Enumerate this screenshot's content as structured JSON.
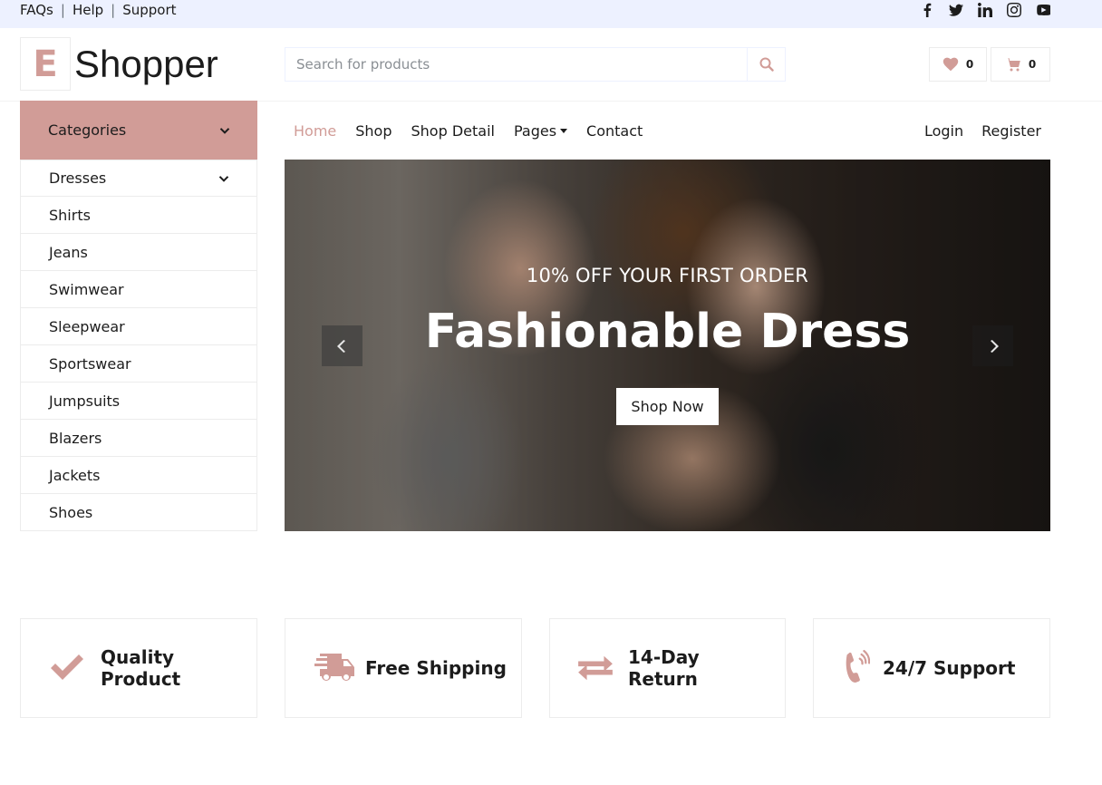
{
  "topbar": {
    "links": [
      "FAQs",
      "Help",
      "Support"
    ],
    "separator": "|",
    "social_icons": [
      "facebook-icon",
      "twitter-icon",
      "linkedin-icon",
      "instagram-icon",
      "youtube-icon"
    ]
  },
  "header": {
    "logo_letter": "E",
    "logo_text": "Shopper",
    "search_placeholder": "Search for products",
    "wishlist_count": "0",
    "cart_count": "0"
  },
  "sidebar": {
    "title": "Categories",
    "items": [
      {
        "label": "Dresses",
        "has_submenu": true
      },
      {
        "label": "Shirts"
      },
      {
        "label": "Jeans"
      },
      {
        "label": "Swimwear"
      },
      {
        "label": "Sleepwear"
      },
      {
        "label": "Sportswear"
      },
      {
        "label": "Jumpsuits"
      },
      {
        "label": "Blazers"
      },
      {
        "label": "Jackets"
      },
      {
        "label": "Shoes"
      }
    ]
  },
  "nav": {
    "items": [
      "Home",
      "Shop",
      "Shop Detail",
      "Pages",
      "Contact"
    ],
    "active": "Home",
    "login": "Login",
    "register": "Register"
  },
  "hero": {
    "subtitle": "10% OFF YOUR FIRST ORDER",
    "title": "Fashionable Dress",
    "button": "Shop Now"
  },
  "features": [
    {
      "line1": "Quality",
      "line2": "Product",
      "icon": "check-icon"
    },
    {
      "line1": "Free Shipping",
      "icon": "shipping-icon"
    },
    {
      "line1": "14-Day",
      "line2": "Return",
      "icon": "exchange-icon"
    },
    {
      "line1": "24/7 Support",
      "icon": "phone-icon"
    }
  ],
  "colors": {
    "accent": "#d19c97",
    "topbar_bg": "#edf1ff",
    "text": "#1c1c1c"
  }
}
